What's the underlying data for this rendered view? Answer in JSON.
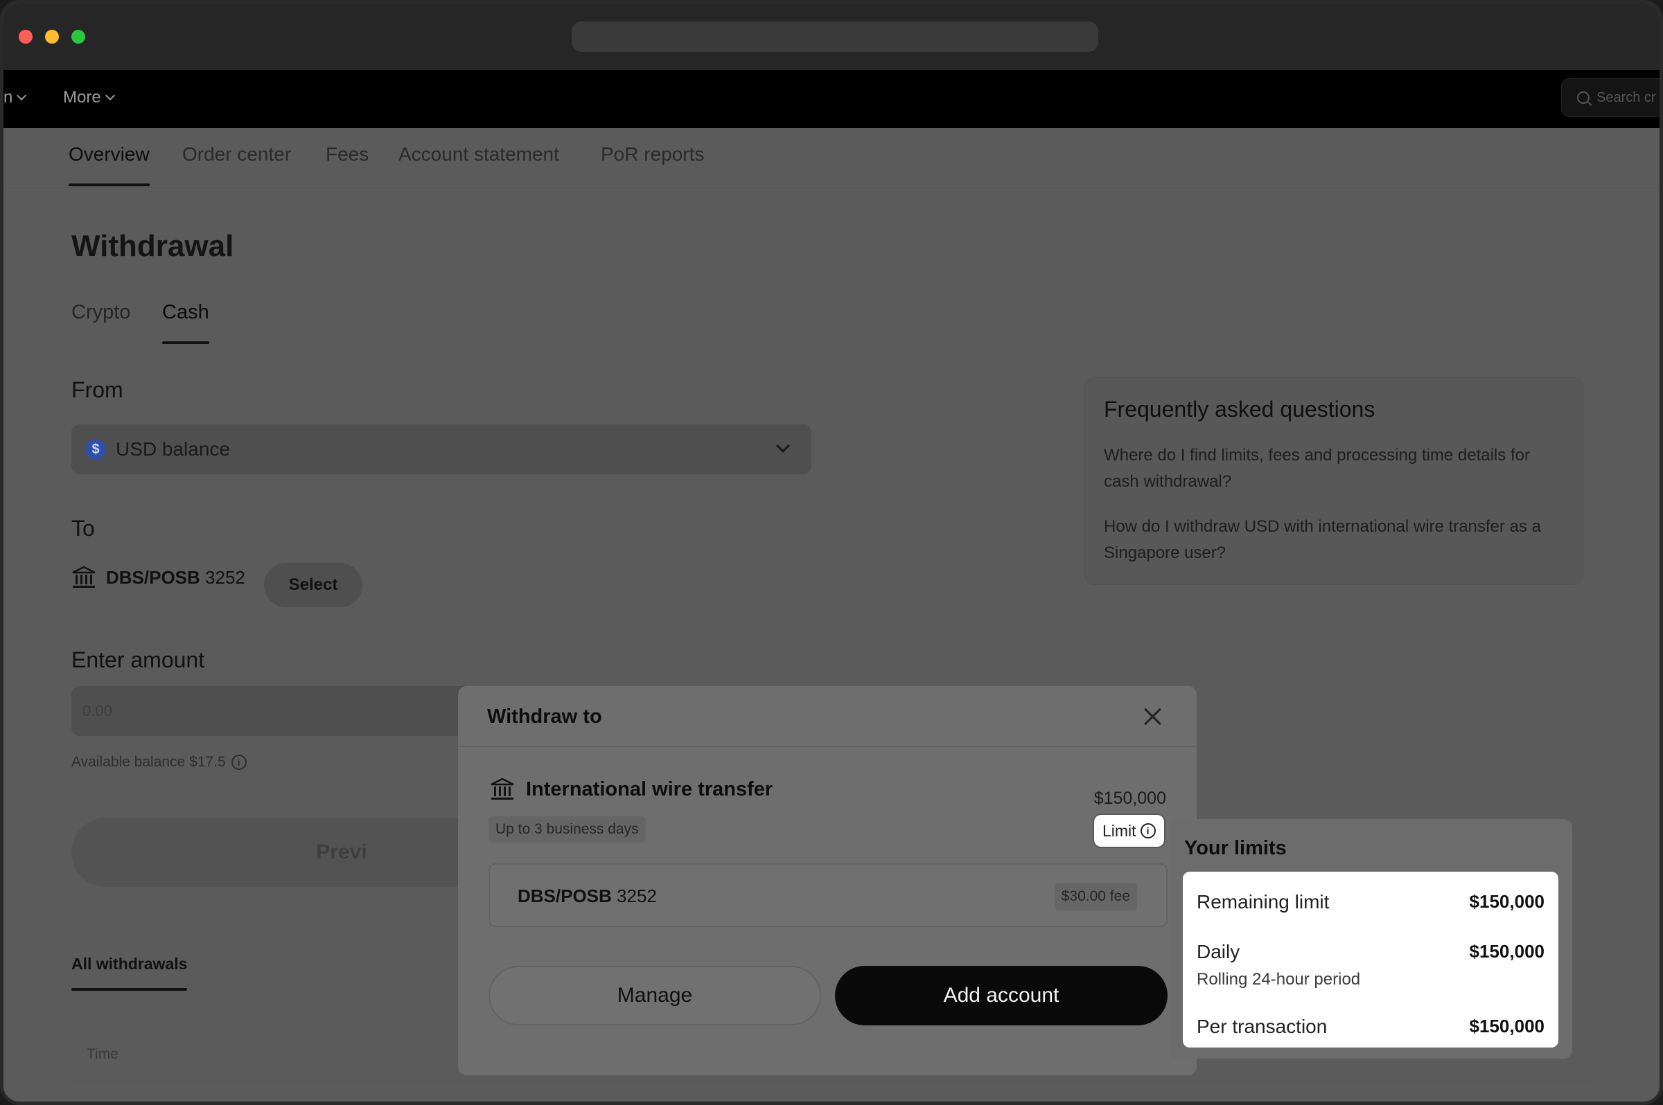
{
  "topnav": {
    "partial_item": "n",
    "more_label": "More",
    "search_placeholder": "Search cr"
  },
  "subtabs": [
    "Overview",
    "Order center",
    "Fees",
    "Account statement",
    "PoR reports"
  ],
  "page": {
    "title": "Withdrawal",
    "method_tabs": [
      "Crypto",
      "Cash"
    ],
    "active_method": "Cash",
    "from_label": "From",
    "from_value": "USD balance",
    "currency_icon": "$",
    "to_label": "To",
    "to_bank": "DBS/POSB",
    "to_account": "3252",
    "select_button": "Select",
    "amount_label": "Enter amount",
    "amount_placeholder": "0.00",
    "available_balance": "Available balance $17.5",
    "preview_button": "Previ",
    "all_withdrawals_tab": "All withdrawals",
    "time_header": "Time"
  },
  "faq": {
    "title": "Frequently asked questions",
    "questions": [
      "Where do I find limits, fees and processing time details for cash withdrawal?",
      "How do I withdraw USD with international wire transfer as a Singapore user?"
    ]
  },
  "modal": {
    "title": "Withdraw to",
    "method_name": "International wire transfer",
    "method_amount": "$150,000",
    "processing_time": "Up to 3 business days",
    "limit_label": "Limit",
    "account_bank": "DBS/POSB",
    "account_number": "3252",
    "account_fee": "$30.00 fee",
    "manage_button": "Manage",
    "add_account_button": "Add account"
  },
  "limits_popover": {
    "title": "Your limits",
    "rows": [
      {
        "label": "Remaining limit",
        "value": "$150,000",
        "sub": ""
      },
      {
        "label": "Daily",
        "value": "$150,000",
        "sub": "Rolling 24-hour period"
      },
      {
        "label": "Per transaction",
        "value": "$150,000",
        "sub": ""
      }
    ]
  },
  "icons": {
    "bank": "bank-icon",
    "info": "info-icon",
    "close": "close-icon",
    "chevron": "chevron-down-icon",
    "search": "search-icon"
  }
}
